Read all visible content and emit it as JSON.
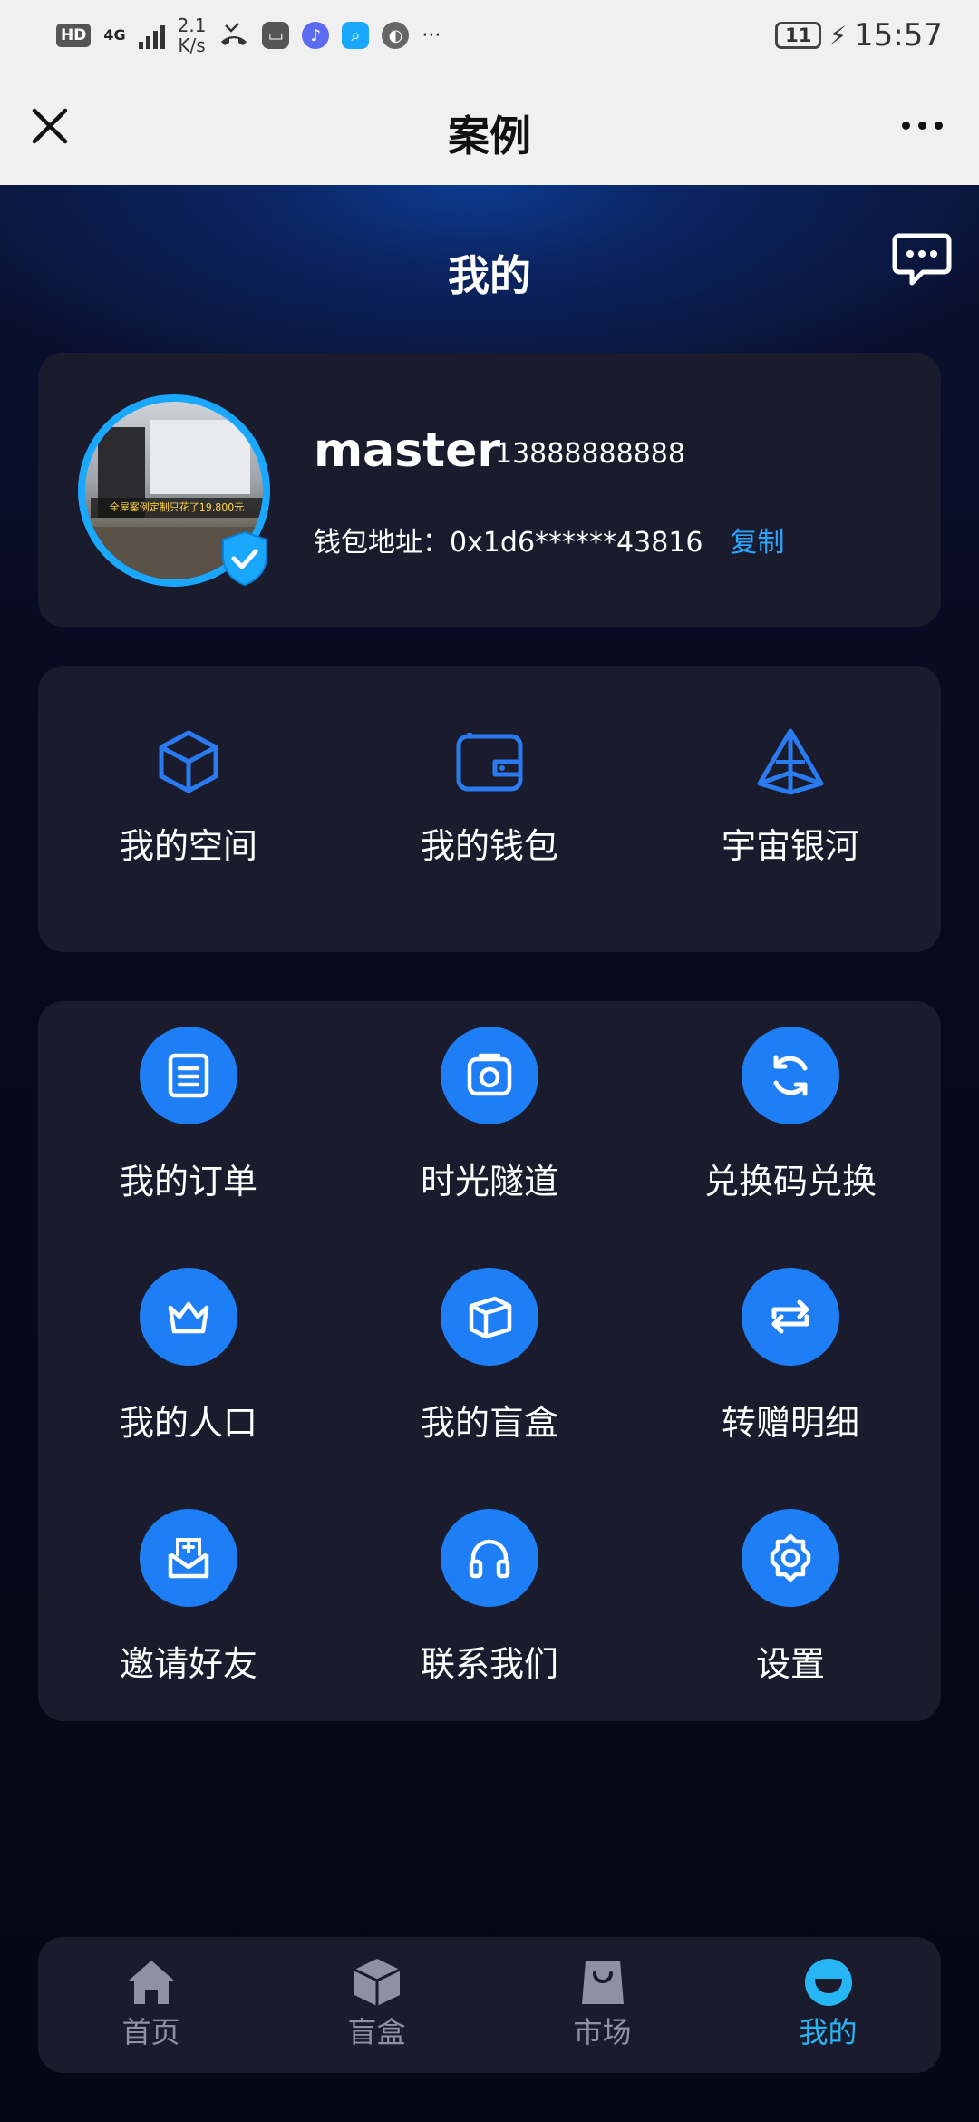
{
  "status_bar": {
    "hd": "HD",
    "network": "4G",
    "speed_value": "2.1",
    "speed_unit": "K/s",
    "more": "···",
    "battery": "11",
    "time": "15:57"
  },
  "title_bar": {
    "title": "案例"
  },
  "header": {
    "title": "我的"
  },
  "profile": {
    "username": "master",
    "phone": "13888888888",
    "wallet_label": "钱包地址：0x1d6******43816",
    "copy_label": "复制",
    "avatar_banner": "全屋案例定制只花了19,800元"
  },
  "quick_actions": [
    {
      "label": "我的空间",
      "icon": "cube-icon"
    },
    {
      "label": "我的钱包",
      "icon": "wallet-icon"
    },
    {
      "label": "宇宙银河",
      "icon": "pyramid-icon"
    }
  ],
  "functions": [
    {
      "label": "我的订单",
      "icon": "order-list-icon"
    },
    {
      "label": "时光隧道",
      "icon": "camera-icon"
    },
    {
      "label": "兑换码兑换",
      "icon": "refresh-icon"
    },
    {
      "label": "我的人口",
      "icon": "crown-icon"
    },
    {
      "label": "我的盲盒",
      "icon": "box-icon"
    },
    {
      "label": "转赠明细",
      "icon": "transfer-icon"
    },
    {
      "label": "邀请好友",
      "icon": "invite-mail-icon"
    },
    {
      "label": "联系我们",
      "icon": "headphones-icon"
    },
    {
      "label": "设置",
      "icon": "settings-gear-icon"
    }
  ],
  "bottom_nav": [
    {
      "label": "首页",
      "icon": "home-icon",
      "active": false
    },
    {
      "label": "盲盒",
      "icon": "box-icon",
      "active": false
    },
    {
      "label": "市场",
      "icon": "shopping-bag-icon",
      "active": false
    },
    {
      "label": "我的",
      "icon": "profile-face-icon",
      "active": true
    }
  ],
  "colors": {
    "background": "#070a1d",
    "card": "#1a1c2e",
    "accent_blue": "#1e7ef5",
    "link_blue": "#2aa4ff",
    "active_nav": "#27b6f5"
  }
}
